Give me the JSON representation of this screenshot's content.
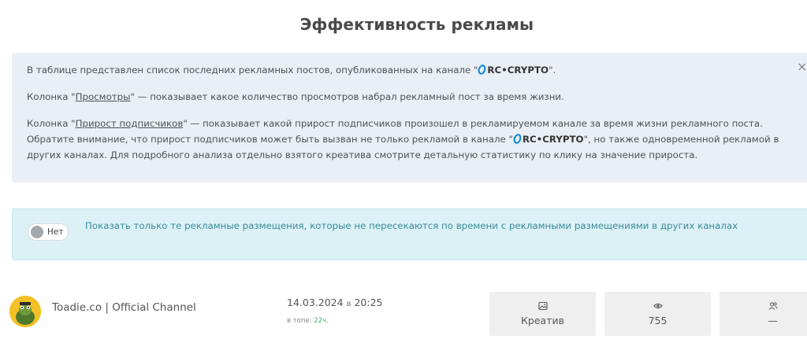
{
  "page": {
    "title": "Эффективность рекламы"
  },
  "info": {
    "p1_before": "В таблице представлен список последних рекламных постов, опубликованных на канале \"",
    "channel": "RC•CRYPTO",
    "p1_after": "\".",
    "p2_before": "Колонка \"",
    "p2_link": "Просмотры",
    "p2_after": "\" — показывает какое количество просмотров набрал рекламный пост за время жизни.",
    "p3_before": "Колонка \"",
    "p3_link": "Прирост подписчиков",
    "p3_after": "\" — показывает какой прирост подписчиков произошел в рекламируемом канале за время жизни рекламного поста.",
    "p3_line2_before": "Обратите внимание, что прирост подписчиков может быть вызван не только рекламой в канале \"",
    "p3_line2_after": "\", но также одновременной рекламой в",
    "p3_line3": "других каналах. Для подробного анализа отдельно взятого креатива смотрите детальную статистику по клику на значение прироста.",
    "close_symbol": "×"
  },
  "filter": {
    "toggle_label": "Нет",
    "text": "Показать только те рекламные размещения, которые не пересекаются по времени с рекламными размещениями в других каналах"
  },
  "post": {
    "channel_name": "Toadie.co | Official Channel",
    "date": "14.03.2024",
    "date_sep": "в",
    "time": "20:25",
    "top_label": "в топе:",
    "top_value": "22ч.",
    "creative_label": "Креатив",
    "views": "755",
    "subs": "—"
  },
  "colors": {
    "accent_teal": "#3c8b97",
    "green": "#3db36b"
  }
}
